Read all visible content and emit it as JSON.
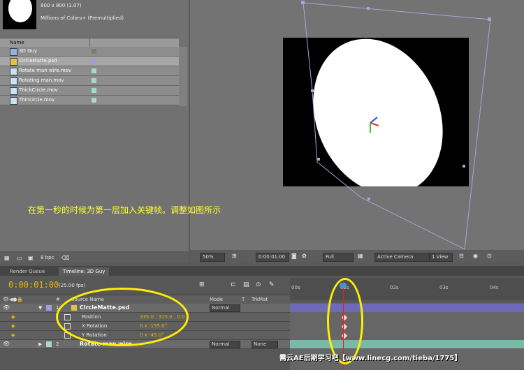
{
  "project": {
    "footage_info": [
      "800 x 800 (1.07)",
      "Millions of Colors+ (Premultiplied)"
    ],
    "column_name": "Name",
    "items": [
      {
        "label": "3D Guy",
        "type": "comp",
        "swatch": "#7a7a7a"
      },
      {
        "label": "CircleMatte.psd",
        "type": "psd",
        "swatch": "#a89ad8"
      },
      {
        "label": "Rotate man wire.mov",
        "type": "mov",
        "swatch": "#a8d8c8"
      },
      {
        "label": "Rotating man.mov",
        "type": "mov",
        "swatch": "#a8d8c8"
      },
      {
        "label": "ThickCircle.mov",
        "type": "mov",
        "swatch": "#a8d8c8"
      },
      {
        "label": "Thincircle.mov",
        "type": "mov",
        "swatch": "#a8d8c8"
      }
    ],
    "bpc": "8 bpc"
  },
  "annotation": "在第一秒的时候为第一层加入关键帧。调整如图所示",
  "viewer": {
    "zoom": "50%",
    "timecode": "0:00:01:00",
    "resolution": "Full",
    "camera": "Active Camera",
    "view": "1 View"
  },
  "tabs": {
    "render_queue": "Render Queue",
    "timeline": "Timeline: 3D Guy"
  },
  "timeline": {
    "current_time": "0:00:01:00",
    "fps": "(25.00 fps)",
    "columns": {
      "num": "#",
      "source": "Source Name",
      "mode": "Mode",
      "t": "T",
      "trkmat": "TrkMat"
    },
    "ruler_ticks": [
      "00s",
      "01s",
      "02s",
      "03s",
      "04s"
    ],
    "layer1": {
      "num": "1",
      "name": "CircleMatte.psd",
      "mode": "Normal"
    },
    "props": [
      {
        "name": "Position",
        "value": "335.0 , 315.0 , 0.0"
      },
      {
        "name": "X Rotation",
        "value": "0 x -155.0°"
      },
      {
        "name": "Y Rotation",
        "value": "0 x -45.0°"
      }
    ],
    "layer2": {
      "num": "2",
      "name": "Rotate man wire.",
      "mode": "Normal",
      "trkmat": "None"
    }
  },
  "watermark": "需云AE后期学习吧【www.linecg.com/tieba/1775】"
}
